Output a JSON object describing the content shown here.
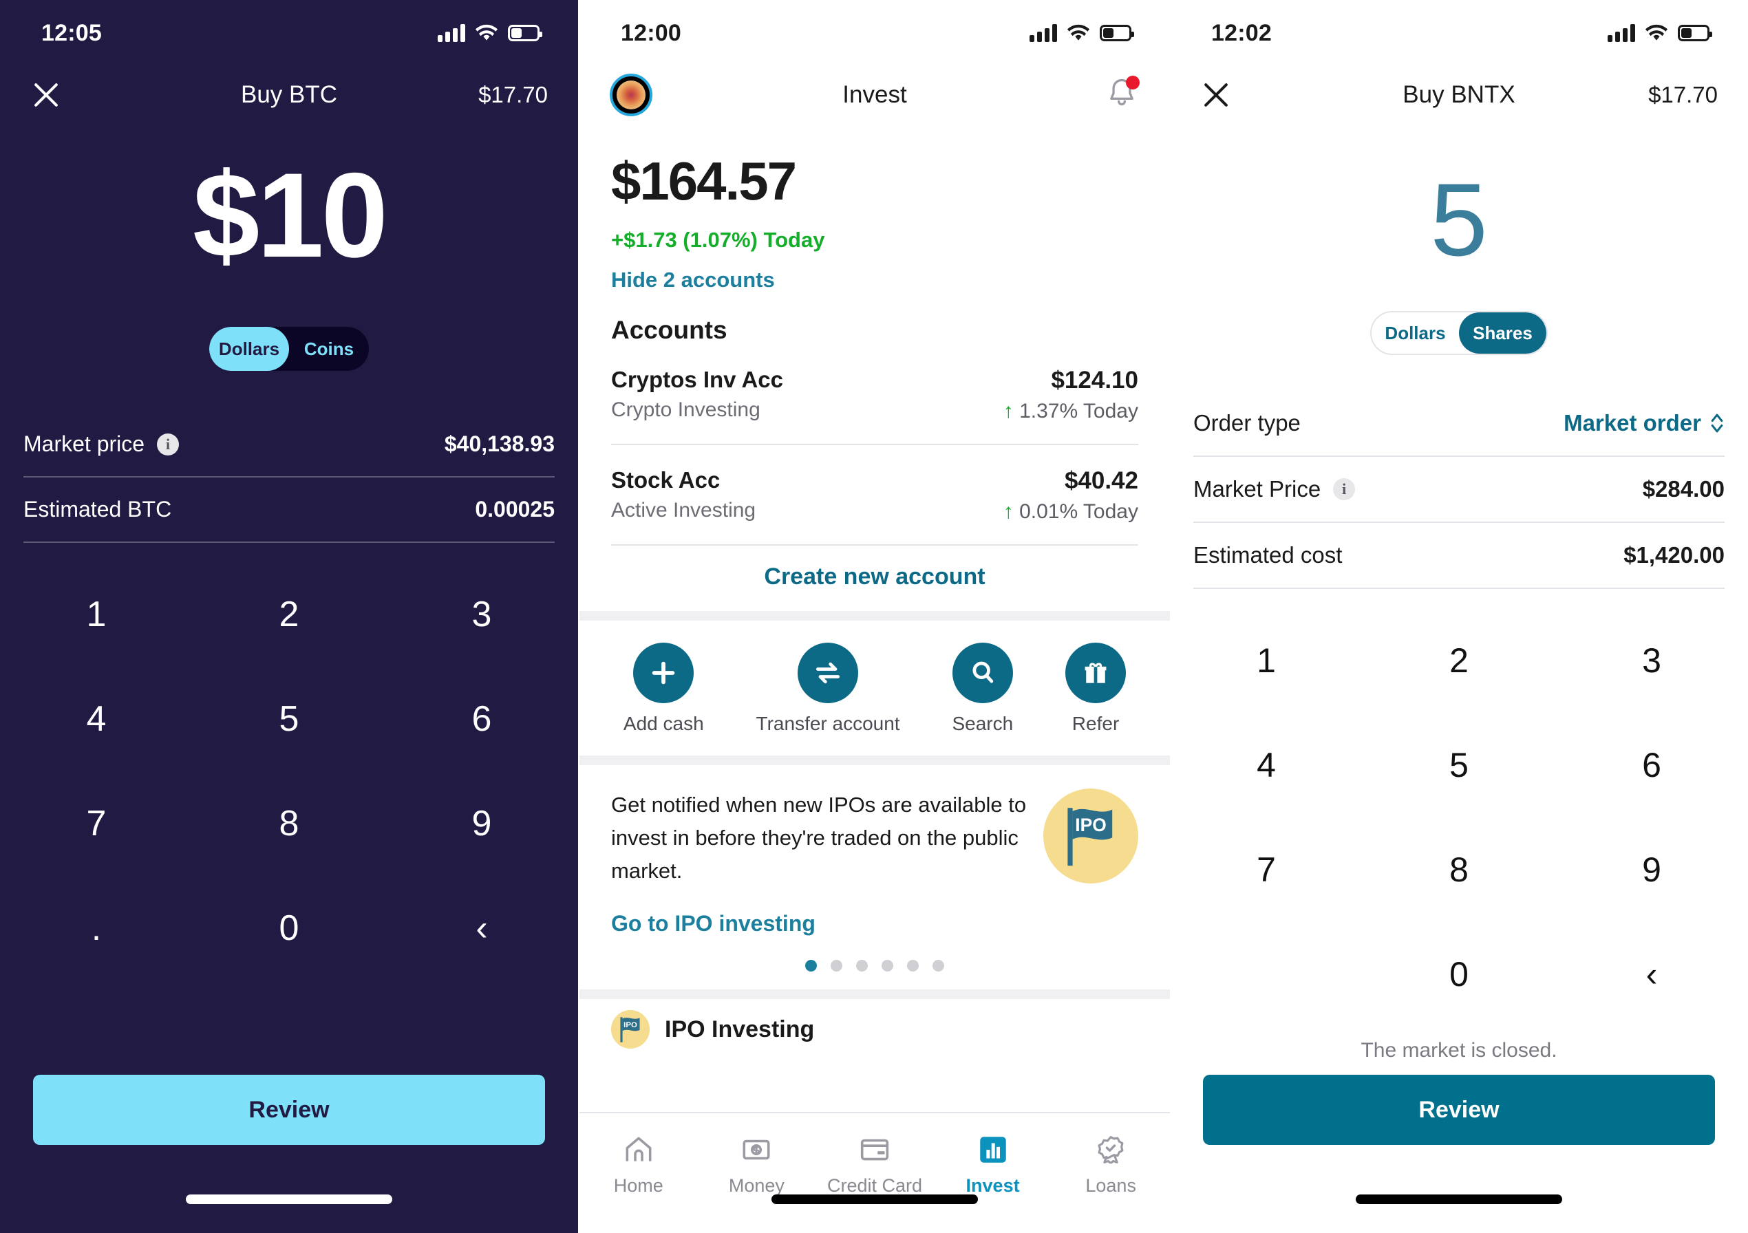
{
  "left": {
    "status": {
      "time": "12:05",
      "signal_icon": "cellular-signal-icon",
      "wifi_icon": "wifi-icon",
      "battery_icon": "battery-icon"
    },
    "header": {
      "close_icon": "close-icon",
      "title": "Buy BTC",
      "price": "$17.70"
    },
    "amount": "$10",
    "toggle": {
      "selected": "Dollars",
      "options": [
        "Dollars",
        "Coins"
      ]
    },
    "rows": [
      {
        "label": "Market price",
        "info_icon": "info-icon",
        "value": "$40,138.93"
      },
      {
        "label": "Estimated BTC",
        "value": "0.00025"
      }
    ],
    "keypad": [
      "1",
      "2",
      "3",
      "4",
      "5",
      "6",
      "7",
      "8",
      "9",
      ".",
      "0",
      "‹"
    ],
    "cta": "Review",
    "colors": {
      "bg": "#211a42",
      "accent": "#7fe0f9",
      "toggle_track": "#0c0626"
    }
  },
  "middle": {
    "status": {
      "time": "12:00",
      "signal_icon": "cellular-signal-icon",
      "wifi_icon": "wifi-icon",
      "battery_icon": "battery-icon"
    },
    "header": {
      "avatar_icon": "avatar",
      "title": "Invest",
      "bell_icon": "bell-icon",
      "bell_has_badge": true
    },
    "balance": "$164.57",
    "change": "+$1.73 (1.07%) Today",
    "hide_accounts": "Hide 2 accounts",
    "accounts_title": "Accounts",
    "accounts": [
      {
        "name": "Cryptos Inv Acc",
        "type": "Crypto Investing",
        "amount": "$124.10",
        "change": "1.37% Today",
        "arrow": "↑"
      },
      {
        "name": "Stock Acc",
        "type": "Active Investing",
        "amount": "$40.42",
        "change": "0.01% Today",
        "arrow": "↑"
      }
    ],
    "create_account": "Create new account",
    "actions": [
      {
        "label": "Add cash",
        "icon": "plus-icon"
      },
      {
        "label": "Transfer account",
        "icon": "transfer-arrows-icon"
      },
      {
        "label": "Search",
        "icon": "search-icon"
      },
      {
        "label": "Refer",
        "icon": "gift-icon"
      }
    ],
    "promo": {
      "text": "Get notified when new IPOs are available to invest in before they're traded on the public market.",
      "badge_text": "IPO",
      "badge_icon": "ipo-flag-icon",
      "link": "Go to IPO investing",
      "dots_total": 6,
      "dots_active": 1
    },
    "list_item": {
      "label": "IPO Investing",
      "badge_text": "IPO",
      "icon": "ipo-flag-icon"
    },
    "tabs": [
      {
        "label": "Home",
        "icon": "home-icon",
        "active": false
      },
      {
        "label": "Money",
        "icon": "money-bill-icon",
        "active": false
      },
      {
        "label": "Credit Card",
        "icon": "credit-card-icon",
        "active": false
      },
      {
        "label": "Invest",
        "icon": "bar-chart-icon",
        "active": true
      },
      {
        "label": "Loans",
        "icon": "badge-check-icon",
        "active": false
      }
    ],
    "colors": {
      "accent": "#0d6a87",
      "positive": "#14ae2b",
      "link": "#1d7f9e",
      "tab_active": "#0c93bd",
      "badge_yellow": "#f5dc8e"
    }
  },
  "right": {
    "status": {
      "time": "12:02",
      "signal_icon": "cellular-signal-icon",
      "wifi_icon": "wifi-icon",
      "battery_icon": "battery-icon"
    },
    "header": {
      "close_icon": "close-icon",
      "title": "Buy BNTX",
      "price": "$17.70"
    },
    "amount": "5",
    "toggle": {
      "selected": "Shares",
      "options": [
        "Dollars",
        "Shares"
      ]
    },
    "rows": [
      {
        "label": "Order type",
        "value": "Market order",
        "is_link": true,
        "stepper_icon": "up-down-chevron-icon"
      },
      {
        "label": "Market Price",
        "info_icon": "info-icon",
        "value": "$284.00"
      },
      {
        "label": "Estimated cost",
        "value": "$1,420.00"
      }
    ],
    "keypad": [
      "1",
      "2",
      "3",
      "4",
      "5",
      "6",
      "7",
      "8",
      "9",
      "",
      "0",
      "‹"
    ],
    "market_note": "The market is closed.",
    "cta": "Review",
    "colors": {
      "accent": "#0d6a87",
      "amount": "#3a7e9b"
    }
  }
}
